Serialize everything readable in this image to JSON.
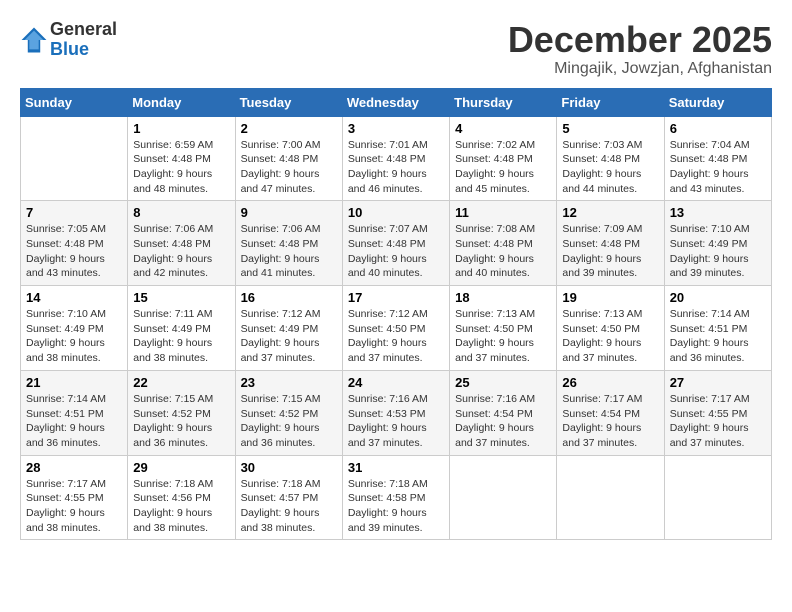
{
  "header": {
    "logo_general": "General",
    "logo_blue": "Blue",
    "month_title": "December 2025",
    "location": "Mingajik, Jowzjan, Afghanistan"
  },
  "calendar": {
    "weekdays": [
      "Sunday",
      "Monday",
      "Tuesday",
      "Wednesday",
      "Thursday",
      "Friday",
      "Saturday"
    ],
    "weeks": [
      [
        {
          "day": "",
          "sunrise": "",
          "sunset": "",
          "daylight": ""
        },
        {
          "day": "1",
          "sunrise": "Sunrise: 6:59 AM",
          "sunset": "Sunset: 4:48 PM",
          "daylight": "Daylight: 9 hours and 48 minutes."
        },
        {
          "day": "2",
          "sunrise": "Sunrise: 7:00 AM",
          "sunset": "Sunset: 4:48 PM",
          "daylight": "Daylight: 9 hours and 47 minutes."
        },
        {
          "day": "3",
          "sunrise": "Sunrise: 7:01 AM",
          "sunset": "Sunset: 4:48 PM",
          "daylight": "Daylight: 9 hours and 46 minutes."
        },
        {
          "day": "4",
          "sunrise": "Sunrise: 7:02 AM",
          "sunset": "Sunset: 4:48 PM",
          "daylight": "Daylight: 9 hours and 45 minutes."
        },
        {
          "day": "5",
          "sunrise": "Sunrise: 7:03 AM",
          "sunset": "Sunset: 4:48 PM",
          "daylight": "Daylight: 9 hours and 44 minutes."
        },
        {
          "day": "6",
          "sunrise": "Sunrise: 7:04 AM",
          "sunset": "Sunset: 4:48 PM",
          "daylight": "Daylight: 9 hours and 43 minutes."
        }
      ],
      [
        {
          "day": "7",
          "sunrise": "Sunrise: 7:05 AM",
          "sunset": "Sunset: 4:48 PM",
          "daylight": "Daylight: 9 hours and 43 minutes."
        },
        {
          "day": "8",
          "sunrise": "Sunrise: 7:06 AM",
          "sunset": "Sunset: 4:48 PM",
          "daylight": "Daylight: 9 hours and 42 minutes."
        },
        {
          "day": "9",
          "sunrise": "Sunrise: 7:06 AM",
          "sunset": "Sunset: 4:48 PM",
          "daylight": "Daylight: 9 hours and 41 minutes."
        },
        {
          "day": "10",
          "sunrise": "Sunrise: 7:07 AM",
          "sunset": "Sunset: 4:48 PM",
          "daylight": "Daylight: 9 hours and 40 minutes."
        },
        {
          "day": "11",
          "sunrise": "Sunrise: 7:08 AM",
          "sunset": "Sunset: 4:48 PM",
          "daylight": "Daylight: 9 hours and 40 minutes."
        },
        {
          "day": "12",
          "sunrise": "Sunrise: 7:09 AM",
          "sunset": "Sunset: 4:48 PM",
          "daylight": "Daylight: 9 hours and 39 minutes."
        },
        {
          "day": "13",
          "sunrise": "Sunrise: 7:10 AM",
          "sunset": "Sunset: 4:49 PM",
          "daylight": "Daylight: 9 hours and 39 minutes."
        }
      ],
      [
        {
          "day": "14",
          "sunrise": "Sunrise: 7:10 AM",
          "sunset": "Sunset: 4:49 PM",
          "daylight": "Daylight: 9 hours and 38 minutes."
        },
        {
          "day": "15",
          "sunrise": "Sunrise: 7:11 AM",
          "sunset": "Sunset: 4:49 PM",
          "daylight": "Daylight: 9 hours and 38 minutes."
        },
        {
          "day": "16",
          "sunrise": "Sunrise: 7:12 AM",
          "sunset": "Sunset: 4:49 PM",
          "daylight": "Daylight: 9 hours and 37 minutes."
        },
        {
          "day": "17",
          "sunrise": "Sunrise: 7:12 AM",
          "sunset": "Sunset: 4:50 PM",
          "daylight": "Daylight: 9 hours and 37 minutes."
        },
        {
          "day": "18",
          "sunrise": "Sunrise: 7:13 AM",
          "sunset": "Sunset: 4:50 PM",
          "daylight": "Daylight: 9 hours and 37 minutes."
        },
        {
          "day": "19",
          "sunrise": "Sunrise: 7:13 AM",
          "sunset": "Sunset: 4:50 PM",
          "daylight": "Daylight: 9 hours and 37 minutes."
        },
        {
          "day": "20",
          "sunrise": "Sunrise: 7:14 AM",
          "sunset": "Sunset: 4:51 PM",
          "daylight": "Daylight: 9 hours and 36 minutes."
        }
      ],
      [
        {
          "day": "21",
          "sunrise": "Sunrise: 7:14 AM",
          "sunset": "Sunset: 4:51 PM",
          "daylight": "Daylight: 9 hours and 36 minutes."
        },
        {
          "day": "22",
          "sunrise": "Sunrise: 7:15 AM",
          "sunset": "Sunset: 4:52 PM",
          "daylight": "Daylight: 9 hours and 36 minutes."
        },
        {
          "day": "23",
          "sunrise": "Sunrise: 7:15 AM",
          "sunset": "Sunset: 4:52 PM",
          "daylight": "Daylight: 9 hours and 36 minutes."
        },
        {
          "day": "24",
          "sunrise": "Sunrise: 7:16 AM",
          "sunset": "Sunset: 4:53 PM",
          "daylight": "Daylight: 9 hours and 37 minutes."
        },
        {
          "day": "25",
          "sunrise": "Sunrise: 7:16 AM",
          "sunset": "Sunset: 4:54 PM",
          "daylight": "Daylight: 9 hours and 37 minutes."
        },
        {
          "day": "26",
          "sunrise": "Sunrise: 7:17 AM",
          "sunset": "Sunset: 4:54 PM",
          "daylight": "Daylight: 9 hours and 37 minutes."
        },
        {
          "day": "27",
          "sunrise": "Sunrise: 7:17 AM",
          "sunset": "Sunset: 4:55 PM",
          "daylight": "Daylight: 9 hours and 37 minutes."
        }
      ],
      [
        {
          "day": "28",
          "sunrise": "Sunrise: 7:17 AM",
          "sunset": "Sunset: 4:55 PM",
          "daylight": "Daylight: 9 hours and 38 minutes."
        },
        {
          "day": "29",
          "sunrise": "Sunrise: 7:18 AM",
          "sunset": "Sunset: 4:56 PM",
          "daylight": "Daylight: 9 hours and 38 minutes."
        },
        {
          "day": "30",
          "sunrise": "Sunrise: 7:18 AM",
          "sunset": "Sunset: 4:57 PM",
          "daylight": "Daylight: 9 hours and 38 minutes."
        },
        {
          "day": "31",
          "sunrise": "Sunrise: 7:18 AM",
          "sunset": "Sunset: 4:58 PM",
          "daylight": "Daylight: 9 hours and 39 minutes."
        },
        {
          "day": "",
          "sunrise": "",
          "sunset": "",
          "daylight": ""
        },
        {
          "day": "",
          "sunrise": "",
          "sunset": "",
          "daylight": ""
        },
        {
          "day": "",
          "sunrise": "",
          "sunset": "",
          "daylight": ""
        }
      ]
    ]
  }
}
